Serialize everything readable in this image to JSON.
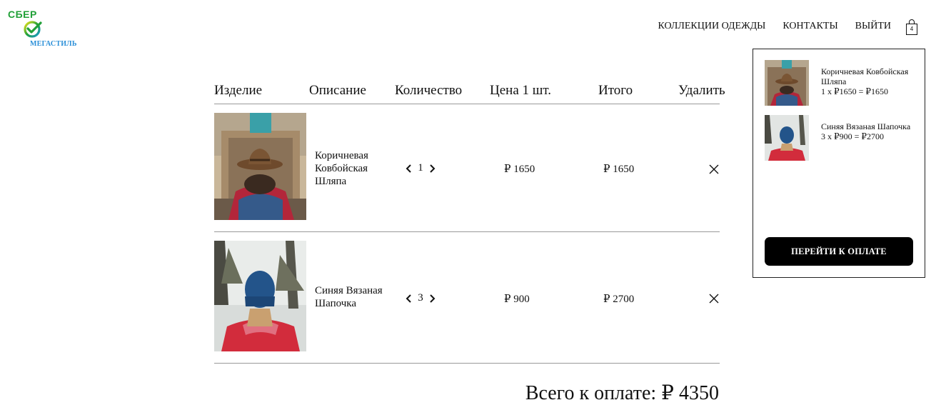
{
  "brand": {
    "top": "СБЕР",
    "bottom": "МЕГАСТИЛЬ",
    "green": "#21a038",
    "blue": "#2a8fd8"
  },
  "nav": {
    "items": [
      "КОЛЛЕКЦИИ ОДЕЖДЫ",
      "КОНТАКТЫ",
      "ВЫЙТИ"
    ],
    "cart_count": "4"
  },
  "table": {
    "headers": {
      "item": "Изделие",
      "description": "Описание",
      "quantity": "Количество",
      "unit_price": "Цена 1 шт.",
      "total": "Итого",
      "delete": "Удалить"
    },
    "rows": [
      {
        "name": "Коричневая Ковбойская Шляпа",
        "qty": "1",
        "price": "₽ 1650",
        "total": "₽ 1650"
      },
      {
        "name": "Синяя Вязаная Шапочка",
        "qty": "3",
        "price": "₽ 900",
        "total": "₽ 2700"
      }
    ]
  },
  "grand_total": "Всего к оплате: ₽ 4350",
  "mini_cart": {
    "items": [
      {
        "name": "Коричневая Ковбойская Шляпа",
        "calc": "1 x ₽1650 = ₽1650"
      },
      {
        "name": "Синяя Вязаная Шапочка",
        "calc": "3 x ₽900 = ₽2700"
      }
    ],
    "checkout_label": "ПЕРЕЙТИ К ОПЛАТЕ"
  }
}
